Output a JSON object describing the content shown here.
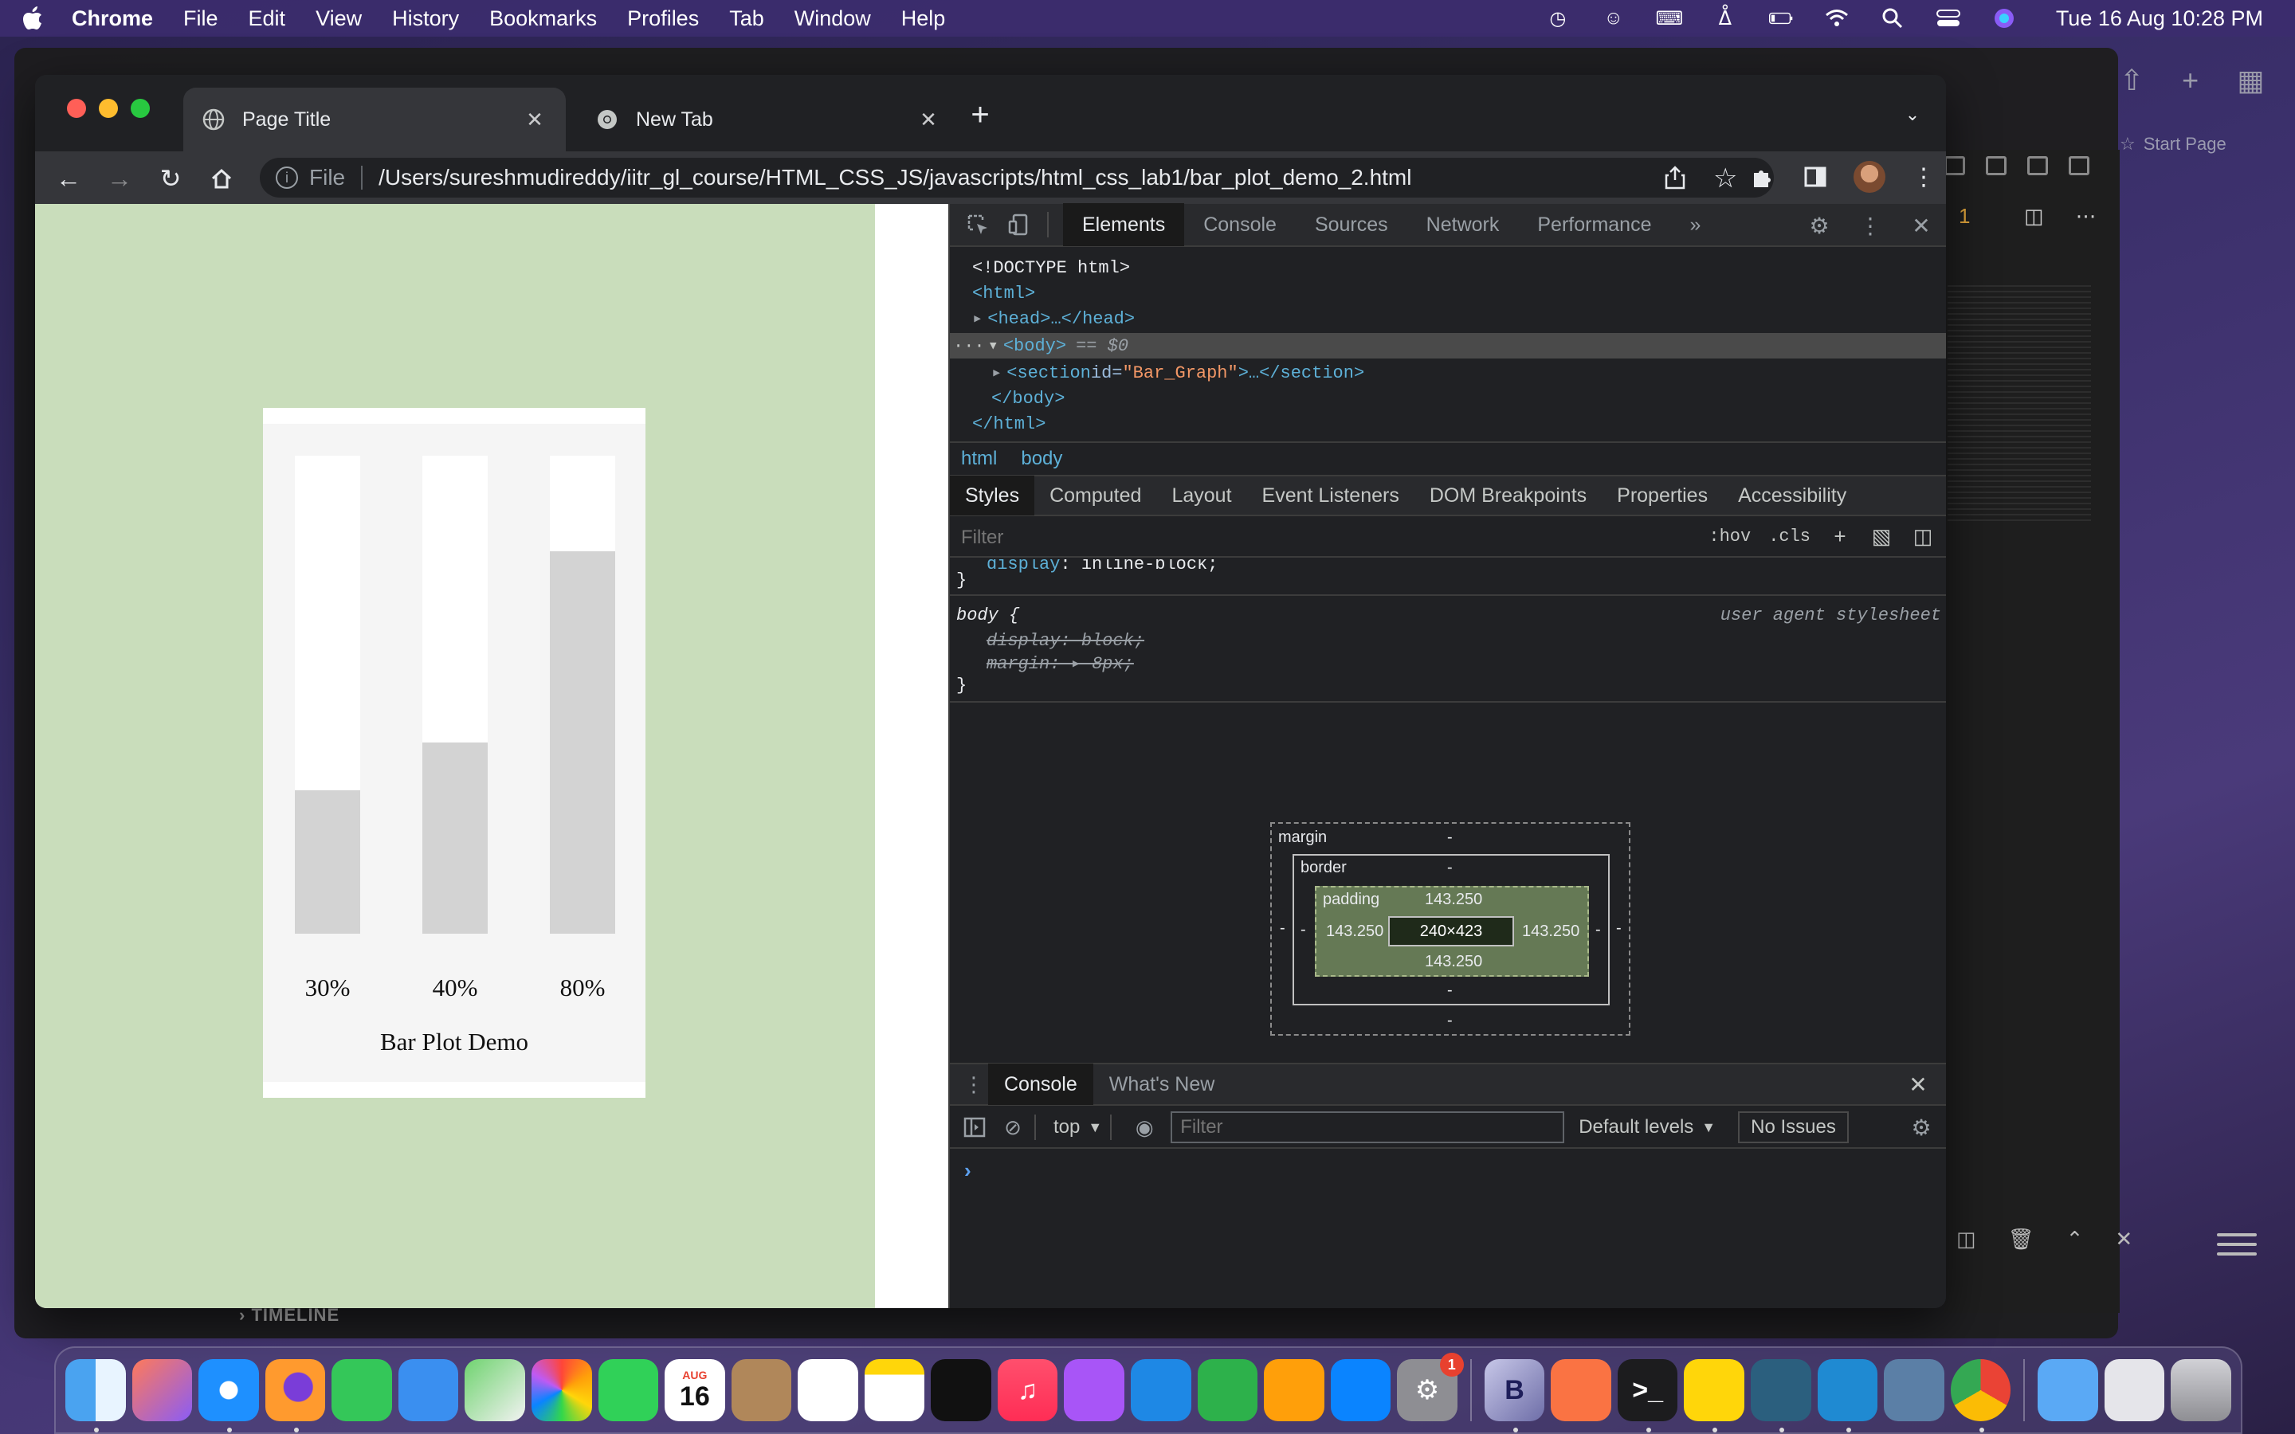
{
  "menubar": {
    "app": "Chrome",
    "items": [
      "File",
      "Edit",
      "View",
      "History",
      "Bookmarks",
      "Profiles",
      "Tab",
      "Window",
      "Help"
    ],
    "clock": "Tue 16 Aug  10:28 PM"
  },
  "background_app": {
    "timeline_label": "TIMELINE",
    "start_page": "Start Page",
    "badge_number": "1"
  },
  "browser": {
    "tabs": [
      {
        "label": "Page Title",
        "icon": "globe-icon",
        "active": true
      },
      {
        "label": "New Tab",
        "icon": "chrome-icon",
        "active": false
      }
    ],
    "omnibox": {
      "scheme": "File",
      "url": "/Users/sureshmudireddy/iitr_gl_course/HTML_CSS_JS/javascripts/html_css_lab1/bar_plot_demo_2.html"
    }
  },
  "page": {
    "background": "#c9ddbb",
    "bars": [
      {
        "label": "30%",
        "value": 30
      },
      {
        "label": "40%",
        "value": 40
      },
      {
        "label": "80%",
        "value": 80
      }
    ],
    "title": "Bar Plot Demo"
  },
  "chart_data": {
    "type": "bar",
    "categories": [
      "30%",
      "40%",
      "80%"
    ],
    "values": [
      30,
      40,
      80
    ],
    "title": "Bar Plot Demo",
    "xlabel": "",
    "ylabel": "",
    "ylim": [
      0,
      100
    ]
  },
  "devtools": {
    "tabs": [
      "Elements",
      "Console",
      "Sources",
      "Network",
      "Performance"
    ],
    "active_tab": "Elements",
    "more": "»",
    "dom": {
      "doctype": "<!DOCTYPE html>",
      "html_open": "<html>",
      "head": "<head>…</head>",
      "body_open": "<body>",
      "body_marker": "== $0",
      "section_tag": "<section ",
      "section_attr_name": "id=",
      "section_attr_val": "\"Bar_Graph\"",
      "section_close": ">…</section>",
      "body_close": "</body>",
      "html_close": "</html>",
      "ellipsis": "···"
    },
    "breadcrumb": [
      "html",
      "body"
    ],
    "styles_tabs": [
      "Styles",
      "Computed",
      "Layout",
      "Event Listeners",
      "DOM Breakpoints",
      "Properties",
      "Accessibility"
    ],
    "styles_filter_placeholder": "Filter",
    "hov": ":hov",
    "cls": ".cls",
    "styles": {
      "prev_rule_prop": "display",
      "prev_rule_value": ": inline-block;",
      "close_brace": "}",
      "selector": "body {",
      "source": "user agent stylesheet",
      "decl1": "display: block;",
      "decl2_prop": "margin",
      "decl2_value": ": ▸ 8px;"
    },
    "boxmodel": {
      "margin_label": "margin",
      "margin_value": "-",
      "border_label": "border",
      "border_value": "-",
      "padding_label": "padding",
      "padding_top": "143.250",
      "padding_left": "143.250",
      "padding_right": "143.250",
      "padding_bottom": "143.250",
      "content": "240×423",
      "side_dash": "-"
    },
    "drawer": {
      "tabs": [
        "Console",
        "What's New"
      ],
      "context": "top",
      "filter_placeholder": "Filter",
      "levels": "Default levels",
      "issues": "No Issues",
      "prompt": "›"
    }
  },
  "dock": {
    "apps": [
      "Finder",
      "Launchpad",
      "Safari",
      "Firefox",
      "Messages",
      "Mail",
      "Maps",
      "Photos",
      "FaceTime",
      "Calendar",
      "Contacts",
      "Reminders",
      "Notes",
      "TV",
      "Music",
      "Podcasts",
      "Keynote",
      "Numbers",
      "Pages",
      "App Store",
      "System Preferences",
      "BBEdit",
      "Swift",
      "Terminal",
      "Stickies",
      "MySQL Workbench",
      "VS Code",
      "Preview",
      "Chrome",
      "Downloads",
      "Documents",
      "Trash"
    ],
    "calendar_month": "AUG",
    "calendar_day": "16",
    "sysprefs_badge": "1",
    "bbedit_letter": "B"
  }
}
